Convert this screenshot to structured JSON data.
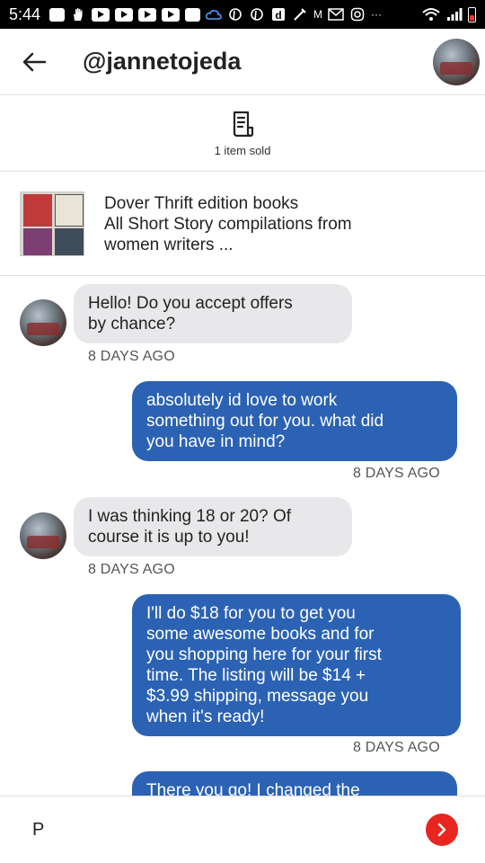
{
  "status_bar": {
    "time": "5:44",
    "icons": [
      "facebook-icon",
      "hand-icon",
      "youtube-icon",
      "youtube-icon",
      "youtube-icon",
      "youtube-icon",
      "facebook-icon",
      "cloud-icon",
      "pinterest-icon",
      "pinterest-icon",
      "d-icon",
      "tools-icon",
      "m-icon",
      "gmail-icon",
      "instagram-icon",
      "more-icon"
    ],
    "more": "···",
    "right_icons": [
      "wifi-icon",
      "signal-icon",
      "battery-icon"
    ]
  },
  "header": {
    "username": "@jannetojeda"
  },
  "sold": {
    "label": "1 item sold"
  },
  "listing": {
    "line1": "Dover Thrift edition books",
    "line2": "All Short Story compilations from",
    "line3": "women writers ..."
  },
  "messages": [
    {
      "direction": "in",
      "lines": [
        "Hello! Do you accept offers",
        "by chance?"
      ],
      "time": "8 DAYS AGO"
    },
    {
      "direction": "out",
      "lines": [
        "absolutely id love to work",
        "something out for you. what did",
        "you have in mind?"
      ],
      "time": "8 DAYS AGO"
    },
    {
      "direction": "in",
      "lines": [
        "I was thinking 18 or 20? Of",
        "course it is up to you!"
      ],
      "time": "8 DAYS AGO"
    },
    {
      "direction": "out",
      "lines": [
        "I'll do $18 for you to get you",
        "some awesome books and for",
        "you shopping here for your first",
        "time.  The listing will be $14 +",
        "$3.99 shipping, message you",
        "when it's ready!"
      ],
      "time": "8 DAYS AGO"
    },
    {
      "direction": "out",
      "lines": [
        "There you go! I changed the"
      ],
      "time": ""
    }
  ],
  "input": {
    "value": "P"
  },
  "colors": {
    "outgoing_bubble": "#2b62b3",
    "incoming_bubble": "#e8e8ea",
    "send_button": "#e8251f"
  }
}
